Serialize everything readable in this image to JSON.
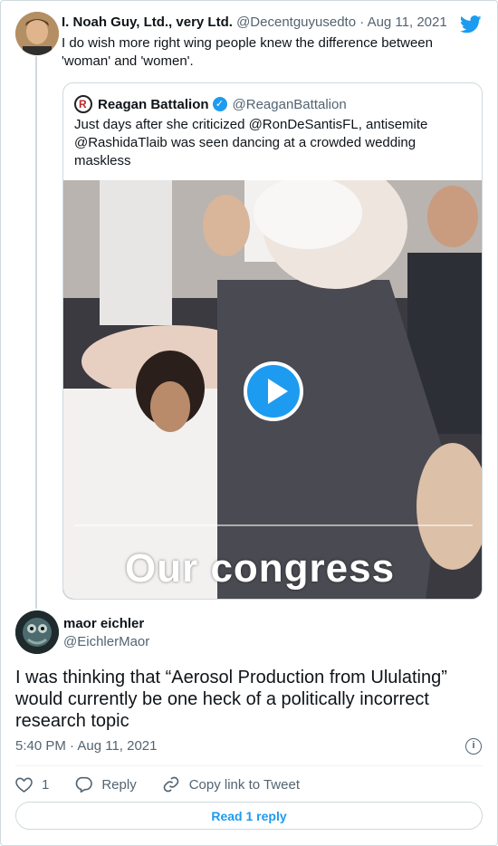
{
  "tweet": {
    "author_name": "I. Noah Guy, Ltd., very Ltd.",
    "author_handle": "@Decentguyusedto",
    "separator": "·",
    "date": "Aug 11, 2021",
    "text": "I do wish more right wing people knew the difference between 'woman' and 'women'."
  },
  "quoted_tweet": {
    "logo_letter": "R",
    "author_name": "Reagan Battalion",
    "verified_glyph": "✓",
    "author_handle": "@ReaganBattalion",
    "text": "Just days after she criticized @RonDeSantisFL, antisemite @RashidaTlaib was seen dancing at a crowded wedding maskless",
    "video": {
      "caption": "Our congress"
    }
  },
  "reply": {
    "author_name": "maor eichler",
    "author_handle": "@EichlerMaor",
    "text": "I was thinking that “Aerosol Production from Ululating” would currently be one heck of a politically incorrect research topic",
    "timestamp": "5:40 PM · Aug 11, 2021",
    "info_glyph": "i"
  },
  "actions": {
    "like_count": "1",
    "reply_label": "Reply",
    "copy_link_label": "Copy link to Tweet"
  },
  "footer": {
    "read_replies_label": "Read 1 reply"
  },
  "colors": {
    "accent": "#1d9bf0",
    "text": "#0f1419",
    "secondary_text": "#536471",
    "border": "#cfd9de"
  },
  "icons": [
    "twitter-bird-icon",
    "verified-badge-icon",
    "play-icon",
    "info-icon",
    "heart-icon",
    "reply-icon",
    "link-icon"
  ]
}
